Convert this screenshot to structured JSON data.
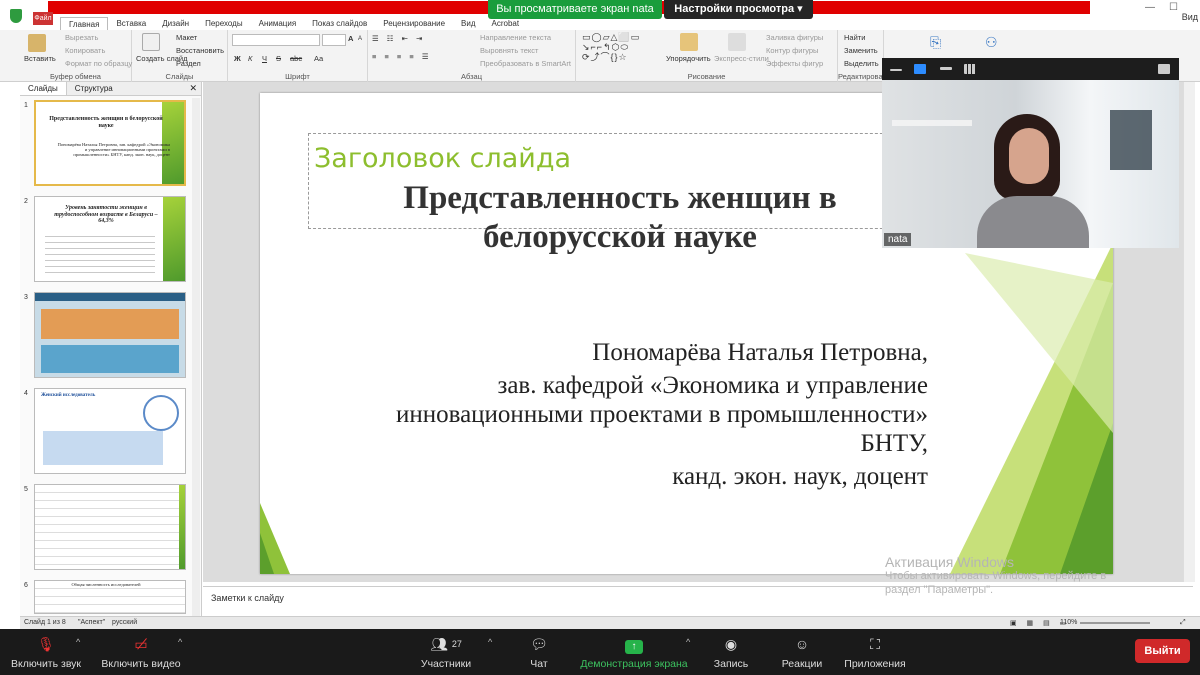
{
  "zoom_top": {
    "share_status": "Вы просматриваете экран nata",
    "view_options": "Настройки просмотра",
    "side_label": "Вид",
    "window_controls": [
      "—",
      "☐"
    ]
  },
  "ppt": {
    "file_tab": "Файл",
    "tabs": [
      "Главная",
      "Вставка",
      "Дизайн",
      "Переходы",
      "Анимация",
      "Показ слайдов",
      "Рецензирование",
      "Вид",
      "Acrobat"
    ],
    "groups": {
      "clipboard": {
        "title": "Буфер обмена",
        "paste": "Вставить",
        "cut": "Вырезать",
        "copy": "Копировать",
        "format": "Формат по образцу"
      },
      "slides": {
        "title": "Слайды",
        "new_slide": "Создать слайд",
        "layout": "Макет",
        "reset": "Восстановить",
        "section": "Раздел"
      },
      "font": {
        "title": "Шрифт",
        "bold": "Ж",
        "italic": "К",
        "underline": "Ч",
        "strike": "S",
        "abc": "abc",
        "caps": "Aa",
        "size_up": "A",
        "size_down": "A"
      },
      "paragraph": {
        "title": "Абзац",
        "text_direction": "Направление текста",
        "align_text": "Выровнять текст",
        "smartart": "Преобразовать в SmartArt"
      },
      "drawing": {
        "title": "Рисование",
        "arrange": "Упорядочить",
        "quick_styles": "Экспресс-стили",
        "fill": "Заливка фигуры",
        "outline": "Контур фигуры",
        "effects": "Эффекты фигур"
      },
      "editing": {
        "title": "Редактирование",
        "find": "Найти",
        "replace": "Заменить",
        "select": "Выделить"
      }
    },
    "panel_tabs": [
      "Слайды",
      "Структура"
    ],
    "thumbnails": [
      {
        "num": "1",
        "title": "Представленность женщин в белорусской науке",
        "sub": "Пономарёва Наталья Петровна, зав. кафедрой «Экономика и управление инновационными проектами в промышленности» БНТУ, канд. экон. наук, доцент"
      },
      {
        "num": "2",
        "title": "Уровень занятости женщин в трудоспособном возрасте в Беларуси – 64,3%",
        "sub": ""
      },
      {
        "num": "3",
        "title": "",
        "sub": ""
      },
      {
        "num": "4",
        "title": "Женский исследователь",
        "sub": ""
      },
      {
        "num": "5",
        "title": "",
        "sub": ""
      },
      {
        "num": "6",
        "title": "Общая численность исследователей",
        "sub": ""
      }
    ],
    "slide": {
      "placeholder_label": "Заголовок слайда",
      "title": "Представленность женщин в белорусской науке",
      "subtitle_lines": [
        "Пономарёва Наталья Петровна,",
        "зав. кафедрой «Экономика и управление инновационными проектами в промышленности» БНТУ,",
        "канд. экон. наук, доцент"
      ]
    },
    "notes_placeholder": "Заметки к слайду",
    "status": {
      "slide_of": "Слайд 1 из 8",
      "theme": "\"Аспект\"",
      "language": "русский",
      "zoom": "110%"
    }
  },
  "windows_activation": {
    "title": "Активация Windows",
    "line1": "Чтобы активировать Windows, перейдите в",
    "line2": "раздел \"Параметры\"."
  },
  "video": {
    "participant_name": "nata"
  },
  "zoom_bar": {
    "mute": "Включить звук",
    "video": "Включить видео",
    "participants": "Участники",
    "participants_count": "27",
    "chat": "Чат",
    "share": "Демонстрация экрана",
    "record": "Запись",
    "reactions": "Реакции",
    "apps": "Приложения",
    "leave": "Выйти"
  },
  "colors": {
    "zoom_green": "#1a9d3c",
    "share_red": "#e00000",
    "slide_green": "#8dbe2e",
    "leave_red": "#d0292a"
  }
}
